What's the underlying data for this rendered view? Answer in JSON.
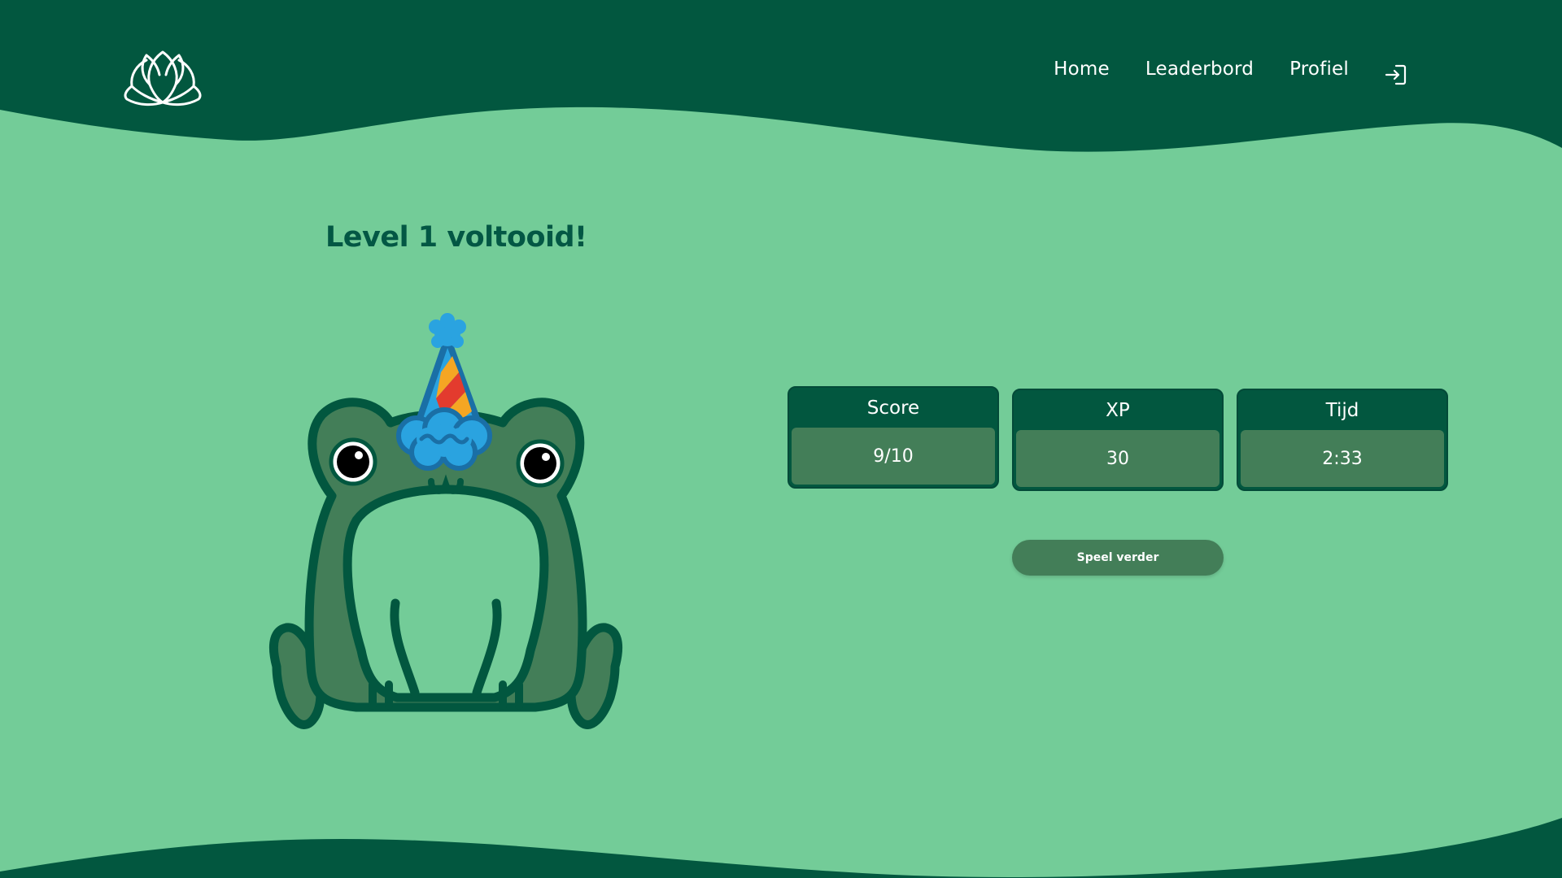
{
  "nav": {
    "home": "Home",
    "leaderboard": "Leaderbord",
    "profile": "Profiel"
  },
  "icons": {
    "logo": "lotus-logo-icon",
    "login": "login-icon",
    "mascot": "party-frog-illustration"
  },
  "main": {
    "title": "Level 1 voltooid!",
    "stats": [
      {
        "label": "Score",
        "value": "9/10"
      },
      {
        "label": "XP",
        "value": "30"
      },
      {
        "label": "Tijd",
        "value": "2:33"
      }
    ],
    "continue_label": "Speel verder"
  },
  "colors": {
    "dark_green": "#02573f",
    "light_green": "#73cc98",
    "medium_green": "#437e58",
    "party_blue": "#2aa3e0",
    "party_red": "#e33b2e",
    "party_orange": "#f5a623"
  }
}
